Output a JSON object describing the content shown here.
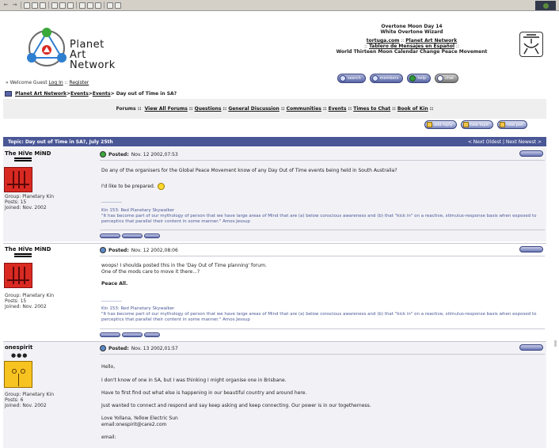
{
  "header": {
    "logo_lines": [
      "Planet",
      "Art",
      "Network"
    ],
    "moon_line_1": "Overtone Moon Day 14",
    "moon_line_2": "White Overtone Wizard",
    "link_1a": "tortuga.com",
    "link_1sep": " :: ",
    "link_1b": "Planet Art Network",
    "link_2pre": ":: ",
    "link_2": "Tablero de Mensajes en Español",
    "link_2post": " ::",
    "tagline": "World Thirteen Moon Calendar Change Peace Movement",
    "pills": [
      "search",
      "members",
      "help",
      "chat"
    ]
  },
  "welcome": {
    "prefix": "» Welcome Guest ",
    "login": "Log In",
    "sep": " :: ",
    "register": "Register"
  },
  "breadcrumb": {
    "home": "Planet Art Network",
    "sep": " > ",
    "events1": "Events",
    "events2": "Events",
    "current": " > Day out of Time in SA?"
  },
  "forums_bar": {
    "label": "Forums ::",
    "links": [
      "View All Forums",
      "Questions",
      "General Discussion",
      "Communities",
      "Events",
      "Times to Chat",
      "Book of Kin"
    ],
    "sep": "::"
  },
  "actions": [
    "add reply",
    "new topic",
    "new poll"
  ],
  "topic": {
    "title": "Topic: Day out of Time in SA?, July 25th",
    "nav_prefix": "< ",
    "oldest": "Next Oldest",
    "sep": " | ",
    "newest": "Next Newest",
    "nav_suffix": " >"
  },
  "posts": [
    {
      "author": "The HiVe MiND",
      "group": "Group: Planetary Kin",
      "posts": "Posts: 15",
      "joined": "Joined: Nov. 2002",
      "posted_label": "Posted:",
      "posted_date": "Nov. 12 2002,07:53",
      "lines": [
        "Do any of the organisers for the Global Peace Movement know of any Day Out of Time events being held in South Australia?",
        "I'd like to be prepared."
      ],
      "sig_rule": "-------------",
      "sig_1": "Kin 153: Red Planetary Skywalker",
      "sig_2": "\"It has become part of our mythology of person that we have large areas of Mind that are (a) below conscious awareness and (b) that \"kick in\" on a reactive, stimulus-response basis when exposed to perceptics that parallel their content in some manner.\" Amos Jessup"
    },
    {
      "author": "The HiVe MiND",
      "group": "Group: Planetary Kin",
      "posts": "Posts: 15",
      "joined": "Joined: Nov. 2002",
      "posted_label": "Posted:",
      "posted_date": "Nov. 12 2002,08:06",
      "lines": [
        "woops! I shoulda posted this in the 'Day Out of Time planning' forum.",
        "One of the mods care to move it there...?",
        "Peace All."
      ],
      "sig_rule": "-------------",
      "sig_1": "Kin 153: Red Planetary Skywalker",
      "sig_2": "\"It has become part of our mythology of person that we have large areas of Mind that are (a) below conscious awareness and (b) that \"kick in\" on a reactive, stimulus-response basis when exposed to perceptics that parallel their content in some manner.\" Amos Jessup"
    },
    {
      "author": "onespirit",
      "group": "Group: Planetary Kin",
      "posts": "Posts: 6",
      "joined": "Joined: Nov. 2002",
      "posted_label": "Posted:",
      "posted_date": "Nov. 13 2002,01:57",
      "lines": [
        "Hello,",
        "I don't know of one in SA, but I was thinking I might organise one in Brisbane.",
        "Have to first find out what else is happening in our beautiful country and around here.",
        "Just wanted to connect and respond and say keep asking and keep connecting. Our power is in our togetherness.",
        "Love Yollana, Yellow Electric Sun",
        "email:onespirit@care2.com",
        "email:",
        "-------------"
      ]
    }
  ]
}
